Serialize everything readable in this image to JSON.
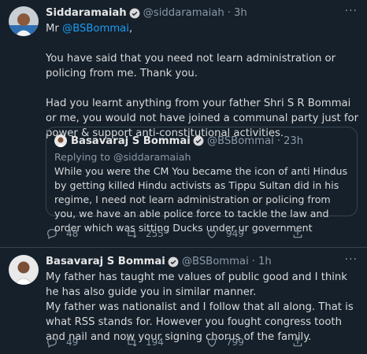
{
  "tweet1": {
    "author_name": "Siddaramaiah",
    "handle": "@siddaramaiah",
    "separator": "·",
    "time": "3h",
    "text_intro": "Mr ",
    "mention": "@BSBommai",
    "text_intro_end": ",",
    "para1": "You have said that you need not learn administration or policing from me. Thank you.",
    "para2": "Had you learnt anything from your father Shri S R Bommai or me, you would not have joined a communal party just for power & support anti-constitutional activities.",
    "quote": {
      "author_name": "Basavaraj S Bommai",
      "handle": "@BSBommai",
      "separator": "·",
      "time": "23h",
      "replying": "Replying to @siddaramaiah",
      "text": "While you were the CM You became the icon of anti Hindus by getting killed Hindu activists as Tippu Sultan did in his regime, I need not learn administration or policing from you, we have an able police force to tackle the law and order which was sitting Ducks under ur government"
    },
    "replies": "48",
    "retweets": "255",
    "likes": "949"
  },
  "tweet2": {
    "author_name": "Basavaraj S Bommai",
    "handle": "@BSBommai",
    "separator": "·",
    "time": "1h",
    "text": "My father has taught me values of public good and I think he has also guide you in similar manner.\nMy father was nationalist and I follow that all along. That is what RSS stands for. However you fought congress tooth and nail and now your signing  chorus of the family.",
    "replies": "49",
    "retweets": "194",
    "likes": "799"
  },
  "colors": {
    "background": "#15202b",
    "accent": "#1d9bf0",
    "muted": "#8b98a5",
    "border": "#38444d"
  },
  "icons": [
    "verified-badge-icon",
    "more-dots-icon",
    "reply-icon",
    "retweet-icon",
    "like-icon",
    "share-icon"
  ]
}
